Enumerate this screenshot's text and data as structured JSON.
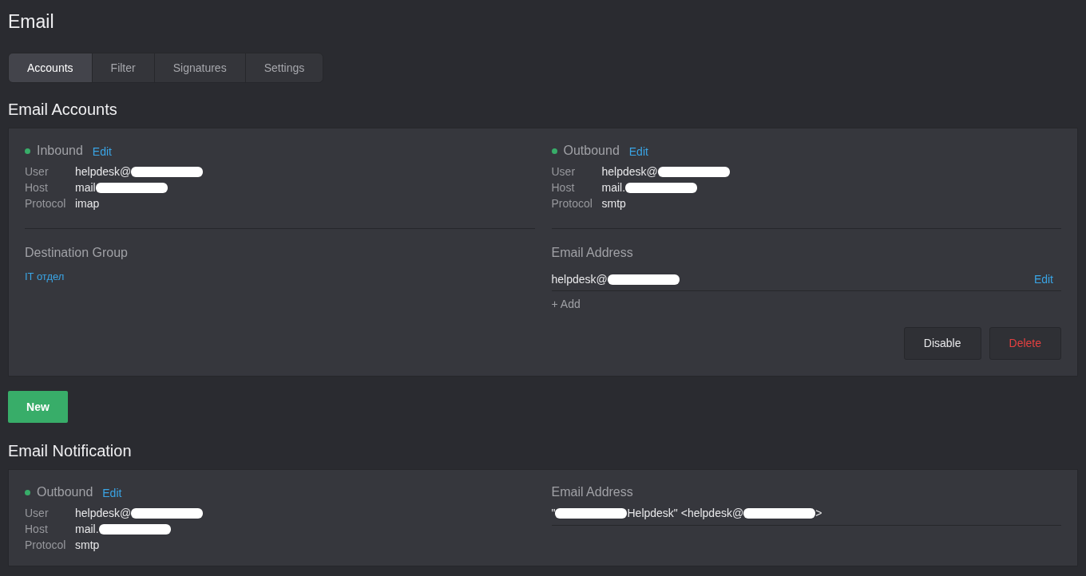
{
  "page_title": "Email",
  "tabs": [
    {
      "label": "Accounts",
      "selected": true
    },
    {
      "label": "Filter",
      "selected": false
    },
    {
      "label": "Signatures",
      "selected": false
    },
    {
      "label": "Settings",
      "selected": false
    }
  ],
  "accounts": {
    "heading": "Email Accounts",
    "inbound": {
      "title": "Inbound",
      "active": true,
      "edit": "Edit",
      "rows": [
        {
          "label": "User",
          "value": [
            {
              "kind": "text",
              "text": "helpdesk@"
            },
            {
              "kind": "redacted"
            }
          ]
        },
        {
          "label": "Host",
          "value": [
            {
              "kind": "text",
              "text": "mail"
            },
            {
              "kind": "redacted"
            }
          ]
        },
        {
          "label": "Protocol",
          "value": [
            {
              "kind": "text",
              "text": "imap"
            }
          ]
        }
      ]
    },
    "outbound": {
      "title": "Outbound",
      "active": true,
      "edit": "Edit",
      "rows": [
        {
          "label": "User",
          "value": [
            {
              "kind": "text",
              "text": "helpdesk@"
            },
            {
              "kind": "redacted"
            }
          ]
        },
        {
          "label": "Host",
          "value": [
            {
              "kind": "text",
              "text": "mail."
            },
            {
              "kind": "redacted"
            }
          ]
        },
        {
          "label": "Protocol",
          "value": [
            {
              "kind": "text",
              "text": "smtp"
            }
          ]
        }
      ]
    },
    "destination_group": {
      "label": "Destination Group",
      "value": "IT отдел"
    },
    "email_address": {
      "label": "Email Address",
      "addresses": [
        {
          "value": [
            {
              "kind": "text",
              "text": "helpdesk@"
            },
            {
              "kind": "redacted"
            }
          ],
          "edit": "Edit"
        }
      ],
      "add": "+ Add"
    },
    "buttons": [
      {
        "label": "Disable",
        "kind": "neutral"
      },
      {
        "label": "Delete",
        "kind": "danger"
      }
    ]
  },
  "new_button": "New",
  "notification": {
    "heading": "Email Notification",
    "outbound": {
      "title": "Outbound",
      "active": true,
      "edit": "Edit",
      "rows": [
        {
          "label": "User",
          "value": [
            {
              "kind": "text",
              "text": "helpdesk@"
            },
            {
              "kind": "redacted"
            }
          ]
        },
        {
          "label": "Host",
          "value": [
            {
              "kind": "text",
              "text": "mail."
            },
            {
              "kind": "redacted"
            }
          ]
        },
        {
          "label": "Protocol",
          "value": [
            {
              "kind": "text",
              "text": "smtp"
            }
          ]
        }
      ]
    },
    "email_address": {
      "label": "Email Address",
      "value": [
        {
          "kind": "text",
          "text": "\""
        },
        {
          "kind": "redacted"
        },
        {
          "kind": "text",
          "text": "Helpdesk\" <helpdesk@"
        },
        {
          "kind": "redacted"
        },
        {
          "kind": "text",
          "text": ">"
        }
      ]
    }
  }
}
